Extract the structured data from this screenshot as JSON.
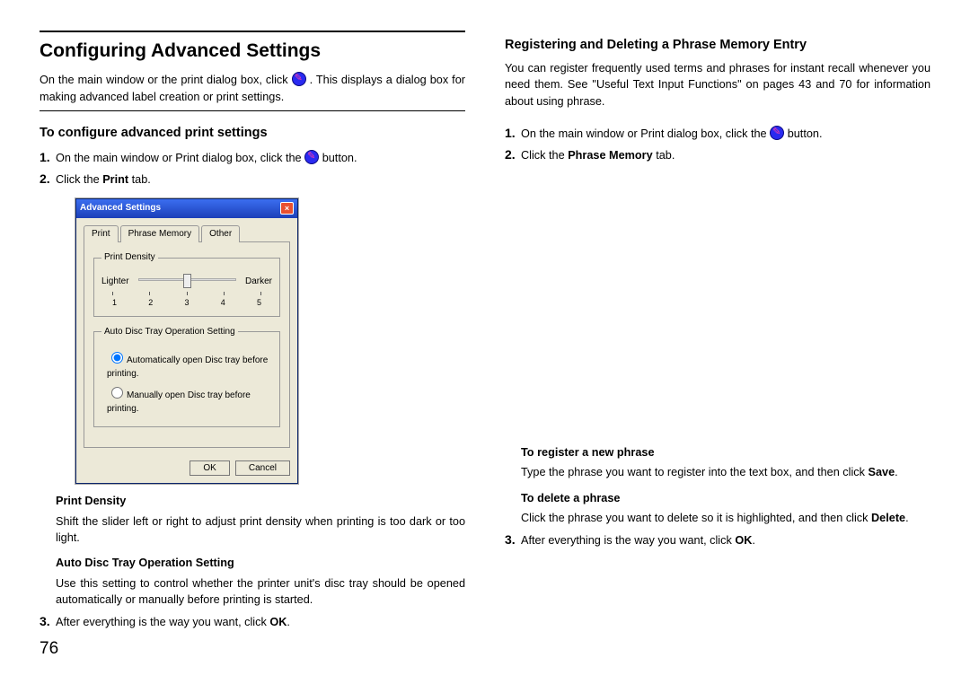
{
  "pageNumber": "76",
  "left": {
    "h1": "Configuring Advanced Settings",
    "intro_a": "On the main window or the print dialog box, click ",
    "intro_b": ". This displays a dialog box for making advanced label creation or print settings.",
    "h2": "To configure advanced print settings",
    "step1_a": "On the main window or Print dialog box, click the ",
    "step1_b": " button.",
    "step2_a": "Click the ",
    "step2_b": " tab.",
    "print_word": "Print",
    "dialog": {
      "title": "Advanced Settings",
      "tabs": {
        "print": "Print",
        "phrase": "Phrase Memory",
        "other": "Other"
      },
      "density_legend": "Print Density",
      "lighter": "Lighter",
      "darker": "Darker",
      "ticks": [
        "1",
        "2",
        "3",
        "4",
        "5"
      ],
      "tray_legend": "Auto Disc Tray Operation Setting",
      "opt1": "Automatically open Disc tray before printing.",
      "opt2": "Manually open Disc tray before printing.",
      "ok": "OK",
      "cancel": "Cancel"
    },
    "pd_head": "Print Density",
    "pd_body": "Shift the slider left or right to adjust print density when printing is too dark or too light.",
    "tray_head": "Auto Disc Tray Operation Setting",
    "tray_body": "Use this setting to control whether the printer unit's disc tray should be opened automatically or manually before printing is started.",
    "step3_a": "After everything is the way you want, click ",
    "ok_word": "OK",
    "step3_b": "."
  },
  "right": {
    "h2": "Registering and Deleting a Phrase Memory Entry",
    "intro": "You can register frequently used terms and phrases for instant recall whenever you need them. See \"Useful Text Input Functions\" on pages 43 and 70 for information about using phrase.",
    "step1_a": "On the main window or Print dialog box, click the ",
    "step1_b": " button.",
    "step2_a": "Click the ",
    "pm_word": "Phrase Memory",
    "step2_b": " tab.",
    "reg_head": "To register a new phrase",
    "reg_body_a": "Type the phrase you want to register into the text box, and then click ",
    "save_word": "Save",
    "reg_body_b": ".",
    "del_head": "To delete a phrase",
    "del_body_a": "Click the phrase you want to delete so it is highlighted, and then click ",
    "delete_word": "Delete",
    "del_body_b": ".",
    "step3_a": "After everything is the way you want, click ",
    "ok_word": "OK",
    "step3_b": "."
  }
}
